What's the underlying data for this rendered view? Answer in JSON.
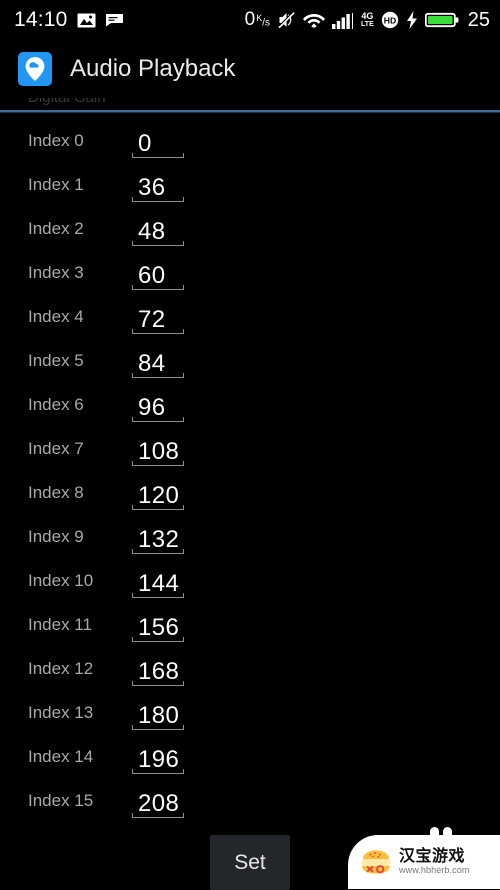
{
  "statusbar": {
    "time": "14:10",
    "icons_left": [
      "photo-icon",
      "message-icon"
    ],
    "data_rate": "0",
    "data_rate_unit_top": "K",
    "data_rate_unit_bottom": "s",
    "icons_right": [
      "mute-icon",
      "wifi-icon",
      "signal-bars-icon",
      "4g-lte-icon",
      "hd-icon",
      "charging-bolt-icon",
      "battery-icon"
    ],
    "lte_top": "4G",
    "lte_bottom": "LTE",
    "hd_label": "HD",
    "battery_percent": "25"
  },
  "appbar": {
    "icon_name": "map-pin-cloud-icon",
    "title": "Audio Playback"
  },
  "section": {
    "clipped_header": "Digital Gain"
  },
  "list": {
    "rows": [
      {
        "label": "Index 0",
        "value": "0"
      },
      {
        "label": "Index 1",
        "value": "36"
      },
      {
        "label": "Index 2",
        "value": "48"
      },
      {
        "label": "Index 3",
        "value": "60"
      },
      {
        "label": "Index 4",
        "value": "72"
      },
      {
        "label": "Index 5",
        "value": "84"
      },
      {
        "label": "Index 6",
        "value": "96"
      },
      {
        "label": "Index 7",
        "value": "108"
      },
      {
        "label": "Index 8",
        "value": "120"
      },
      {
        "label": "Index 9",
        "value": "132"
      },
      {
        "label": "Index 10",
        "value": "144"
      },
      {
        "label": "Index 11",
        "value": "156"
      },
      {
        "label": "Index 12",
        "value": "168"
      },
      {
        "label": "Index 13",
        "value": "180"
      },
      {
        "label": "Index 14",
        "value": "196"
      },
      {
        "label": "Index 15",
        "value": "208"
      }
    ]
  },
  "footer": {
    "set_label": "Set"
  },
  "watermark": {
    "logo_name": "burger-face-logo",
    "brand": "汉宝游戏",
    "url": "www.hbherb.com"
  },
  "colors": {
    "background": "#000000",
    "accent_blue": "#2196f3",
    "rule_blue": "#3d6e99",
    "label_gray": "#a8a8a8",
    "value_white": "#fdfdfd",
    "button_bg": "#23272b",
    "battery_green": "#3ddc3d"
  }
}
